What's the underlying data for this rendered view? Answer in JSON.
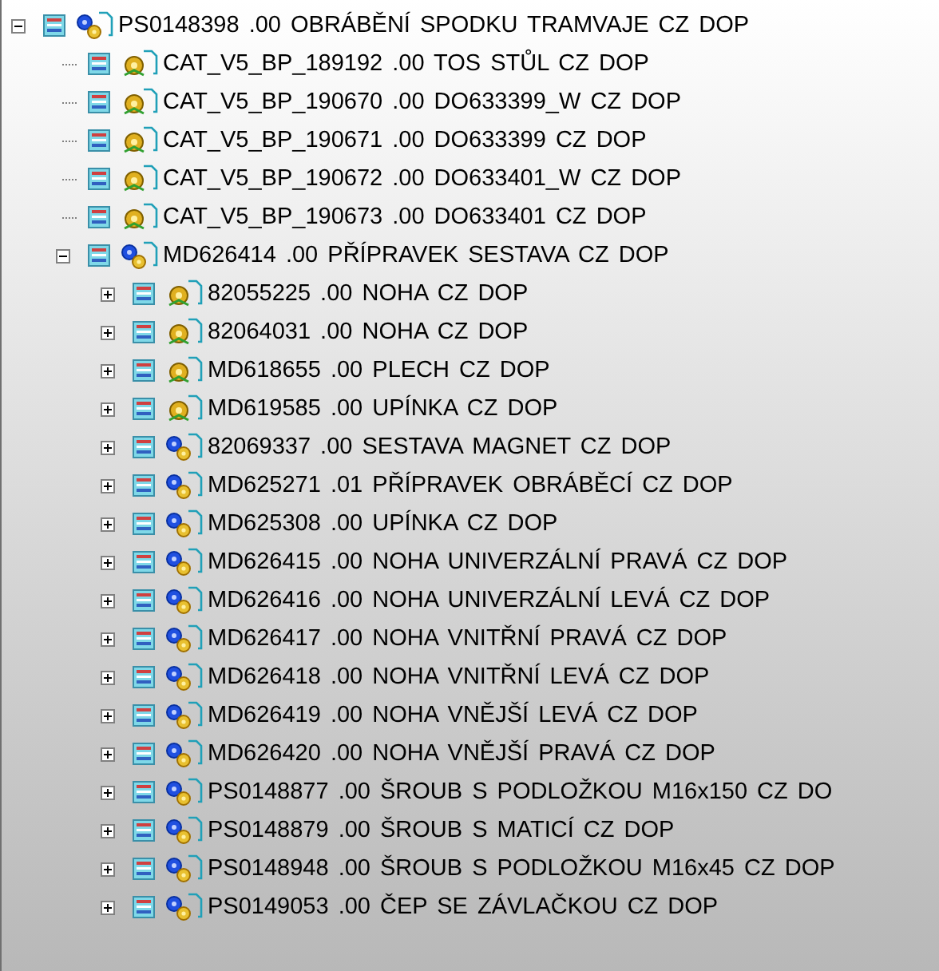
{
  "tree": [
    {
      "label": "PS0148398 .00 OBRÁBĚNÍ SPODKU TRAMVAJE CZ DOP",
      "kind": "product",
      "expanded": true,
      "children": [
        {
          "label": "CAT_V5_BP_189192 .00 TOS STŮL CZ DOP",
          "kind": "part"
        },
        {
          "label": "CAT_V5_BP_190670 .00 DO633399_W CZ DOP",
          "kind": "part"
        },
        {
          "label": "CAT_V5_BP_190671 .00 DO633399 CZ DOP",
          "kind": "part"
        },
        {
          "label": "CAT_V5_BP_190672 .00 DO633401_W CZ DOP",
          "kind": "part"
        },
        {
          "label": "CAT_V5_BP_190673 .00 DO633401 CZ DOP",
          "kind": "part"
        },
        {
          "label": "MD626414 .00 PŘÍPRAVEK SESTAVA CZ DOP",
          "kind": "product",
          "expanded": true,
          "children": [
            {
              "label": "82055225 .00 NOHA CZ DOP",
              "kind": "part",
              "expanded": false
            },
            {
              "label": "82064031 .00 NOHA CZ DOP",
              "kind": "part",
              "expanded": false
            },
            {
              "label": "MD618655 .00 PLECH CZ DOP",
              "kind": "part",
              "expanded": false
            },
            {
              "label": "MD619585 .00 UPÍNKA CZ DOP",
              "kind": "part",
              "expanded": false
            },
            {
              "label": "82069337 .00 SESTAVA MAGNET CZ DOP",
              "kind": "product",
              "expanded": false
            },
            {
              "label": "MD625271 .01 PŘÍPRAVEK OBRÁBĚCÍ CZ DOP",
              "kind": "product",
              "expanded": false
            },
            {
              "label": "MD625308 .00 UPÍNKA CZ DOP",
              "kind": "product",
              "expanded": false
            },
            {
              "label": "MD626415 .00 NOHA UNIVERZÁLNÍ PRAVÁ CZ DOP",
              "kind": "product",
              "expanded": false
            },
            {
              "label": "MD626416 .00 NOHA UNIVERZÁLNÍ LEVÁ CZ DOP",
              "kind": "product",
              "expanded": false
            },
            {
              "label": "MD626417 .00 NOHA VNITŘNÍ PRAVÁ CZ DOP",
              "kind": "product",
              "expanded": false
            },
            {
              "label": "MD626418 .00 NOHA VNITŘNÍ LEVÁ CZ DOP",
              "kind": "product",
              "expanded": false
            },
            {
              "label": "MD626419 .00 NOHA VNĚJŠÍ LEVÁ CZ DOP",
              "kind": "product",
              "expanded": false
            },
            {
              "label": "MD626420 .00 NOHA VNĚJŠÍ PRAVÁ CZ DOP",
              "kind": "product",
              "expanded": false
            },
            {
              "label": "PS0148877 .00 ŠROUB S PODLOŽKOU M16x150 CZ DO",
              "kind": "product",
              "expanded": false
            },
            {
              "label": "PS0148879 .00 ŠROUB S MATICÍ CZ DOP",
              "kind": "product",
              "expanded": false
            },
            {
              "label": "PS0148948 .00 ŠROUB S PODLOŽKOU M16x45 CZ DOP",
              "kind": "product",
              "expanded": false
            },
            {
              "label": "PS0149053 .00 ČEP SE ZÁVLAČKOU CZ DOP",
              "kind": "product",
              "expanded": false
            }
          ]
        }
      ]
    }
  ]
}
